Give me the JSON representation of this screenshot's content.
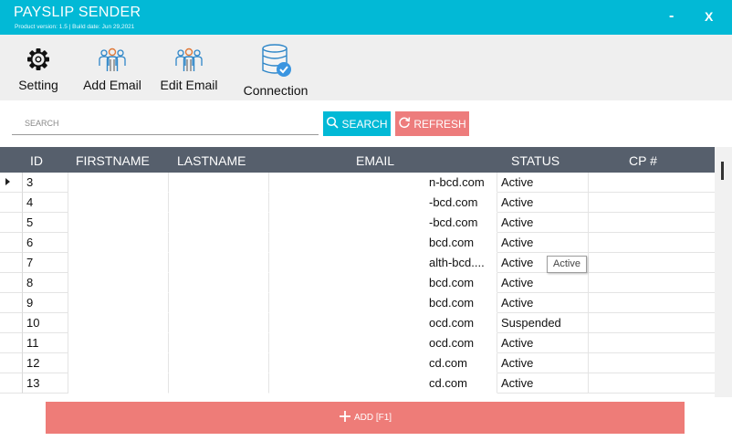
{
  "window": {
    "title": "PAYSLIP SENDER",
    "subtitle": "Product version: 1.5 | Build date: Jun 29,2021",
    "minimize_label": "-",
    "close_label": "X"
  },
  "toolbar": {
    "items": [
      {
        "label": "Setting",
        "icon": "gear-icon"
      },
      {
        "label": "Add Email",
        "icon": "add-users-icon"
      },
      {
        "label": "Edit Email",
        "icon": "edit-users-icon"
      },
      {
        "label": "Connection",
        "icon": "database-check-icon"
      }
    ]
  },
  "search": {
    "placeholder": "SEARCH",
    "value": "",
    "search_button_label": "SEARCH",
    "refresh_button_label": "REFRESH"
  },
  "grid": {
    "columns": [
      "ID",
      "FIRSTNAME",
      "LASTNAME",
      "EMAIL",
      "STATUS",
      "CP #"
    ],
    "rows": [
      {
        "id": "3",
        "firstname": "",
        "lastname": "",
        "email": "n-bcd.com",
        "status": "Active",
        "cp": ""
      },
      {
        "id": "4",
        "firstname": "",
        "lastname": "",
        "email": "-bcd.com",
        "status": "Active",
        "cp": ""
      },
      {
        "id": "5",
        "firstname": "",
        "lastname": "",
        "email": "-bcd.com",
        "status": "Active",
        "cp": ""
      },
      {
        "id": "6",
        "firstname": "",
        "lastname": "",
        "email": "bcd.com",
        "status": "Active",
        "cp": ""
      },
      {
        "id": "7",
        "firstname": "",
        "lastname": "",
        "email": "alth-bcd....",
        "status": "Active",
        "cp": ""
      },
      {
        "id": "8",
        "firstname": "",
        "lastname": "",
        "email": "bcd.com",
        "status": "Active",
        "cp": ""
      },
      {
        "id": "9",
        "firstname": "",
        "lastname": "",
        "email": "bcd.com",
        "status": "Active",
        "cp": ""
      },
      {
        "id": "10",
        "firstname": "",
        "lastname": "",
        "email": "ocd.com",
        "status": "Suspended",
        "cp": ""
      },
      {
        "id": "11",
        "firstname": "",
        "lastname": "",
        "email": "ocd.com",
        "status": "Active",
        "cp": ""
      },
      {
        "id": "12",
        "firstname": "",
        "lastname": "",
        "email": "cd.com",
        "status": "Active",
        "cp": ""
      },
      {
        "id": "13",
        "firstname": "",
        "lastname": "",
        "email": "cd.com",
        "status": "Active",
        "cp": ""
      }
    ],
    "tooltip": "Active"
  },
  "footer": {
    "add_button_label": "ADD [F1]"
  },
  "colors": {
    "accent": "#02b9d6",
    "danger": "#ed7c7c",
    "header_bg": "#565f6c"
  }
}
